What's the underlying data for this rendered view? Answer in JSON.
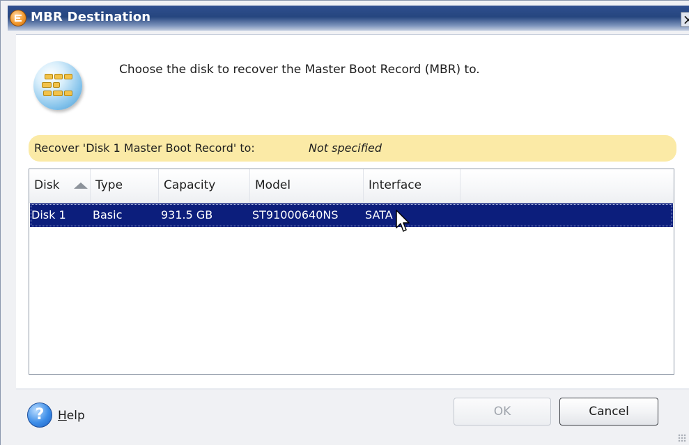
{
  "window": {
    "title": "MBR Destination",
    "close_glyph": "×"
  },
  "dialog": {
    "instruction": "Choose the disk to recover the Master Boot Record (MBR) to.",
    "status_label": "Recover 'Disk 1 Master Boot Record' to:",
    "status_value": "Not specified"
  },
  "table": {
    "sorted_column": "Disk",
    "sort_direction": "ascending",
    "columns": [
      "Disk",
      "Type",
      "Capacity",
      "Model",
      "Interface"
    ],
    "rows": [
      {
        "disk": "Disk 1",
        "type": "Basic",
        "capacity": "931.5 GB",
        "model": "ST91000640NS",
        "interface": "SATA",
        "selected": true
      }
    ]
  },
  "footer": {
    "help_label": "Help",
    "ok_label": "OK",
    "ok_enabled": false,
    "cancel_label": "Cancel"
  },
  "icons": {
    "app": "app-logo-icon",
    "header": "disk-partitions-icon",
    "help": "help-question-icon",
    "sort": "sort-ascending-icon",
    "cursor": "mouse-pointer-icon"
  },
  "colors": {
    "titlebar": "#26467f",
    "selection": "#0c1e7c",
    "banner": "#fbeaa6"
  }
}
